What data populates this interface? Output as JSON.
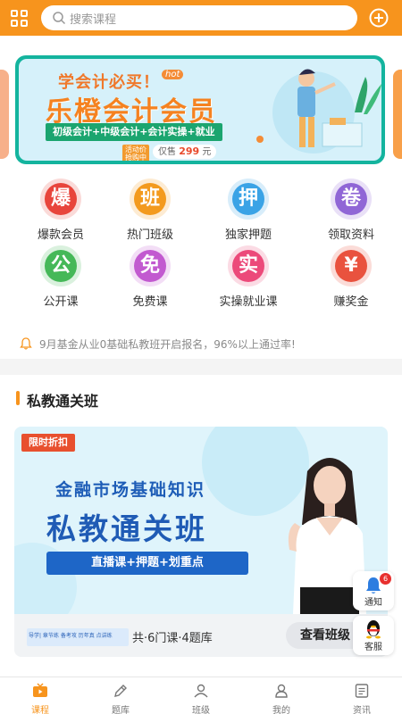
{
  "header": {
    "search_placeholder": "搜索课程",
    "menu_icon": "grid-icon",
    "add_icon": "plus-circle-icon"
  },
  "banner": {
    "headline": "学会计必买！",
    "hot_tag": "hot",
    "title": "乐橙会计会员",
    "subtitle": "初级会计+中级会计+会计实操+就业",
    "promo_label": "活动价抢购中",
    "price_prefix": "仅售",
    "price": "299",
    "price_unit": "元"
  },
  "categories": [
    {
      "glyph": "爆",
      "label": "爆款会员",
      "color": "#e8453c"
    },
    {
      "glyph": "班",
      "label": "热门班级",
      "color": "#f39a1e"
    },
    {
      "glyph": "押",
      "label": "独家押题",
      "color": "#3aa3e6"
    },
    {
      "glyph": "卷",
      "label": "领取资料",
      "color": "#9066d6",
      "icon": "gift-icon"
    },
    {
      "glyph": "公",
      "label": "公开课",
      "color": "#45b858"
    },
    {
      "glyph": "免",
      "label": "免费课",
      "color": "#c25ad0"
    },
    {
      "glyph": "实",
      "label": "实操就业课",
      "color": "#ec4a7a"
    },
    {
      "glyph": "¥",
      "label": "赚奖金",
      "color": "#e9523e",
      "icon": "money-icon"
    }
  ],
  "notice": {
    "icon": "bell-icon",
    "text": "9月基金从业0基础私教班开启报名，96%以上通过率!"
  },
  "section": {
    "title": "私教通关班"
  },
  "course": {
    "tag": "限时折扣",
    "subtitle": "金融市场基础知识",
    "title": "私教通关班",
    "features": "直播课+押题+划重点",
    "mini_text": "导学| 章节练 备考攻 历年真 点讲练",
    "meta": "共·6门课·4题库",
    "button": "查看班级"
  },
  "floating": {
    "notify_label": "通知",
    "notify_count": "6",
    "service_label": "客服"
  },
  "tabs": [
    {
      "label": "课程",
      "icon": "tv-icon",
      "active": true
    },
    {
      "label": "题库",
      "icon": "pencil-icon",
      "active": false
    },
    {
      "label": "班级",
      "icon": "group-icon",
      "active": false
    },
    {
      "label": "我的",
      "icon": "user-icon",
      "active": false
    },
    {
      "label": "资讯",
      "icon": "news-icon",
      "active": false
    }
  ],
  "colors": {
    "brand": "#f7941d",
    "accent_blue": "#1f5bb5",
    "discount": "#e8502e"
  }
}
